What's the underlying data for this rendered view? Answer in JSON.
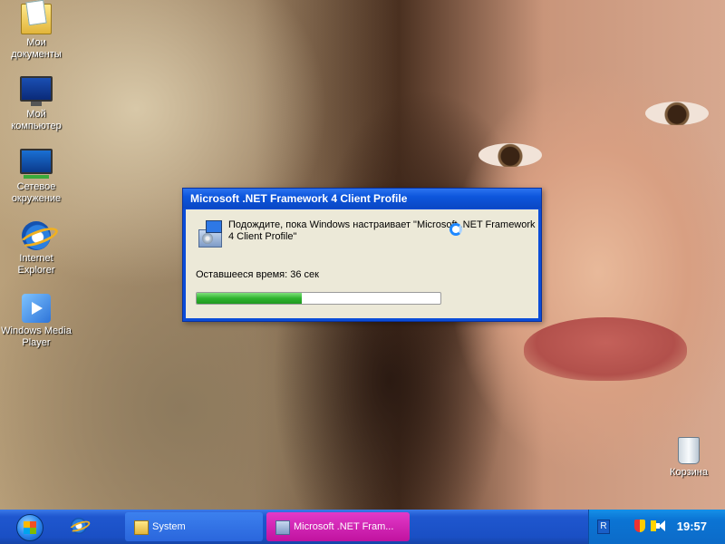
{
  "desktop": {
    "icons": [
      {
        "label": "Мои документы",
        "icon": "documents-folder-icon"
      },
      {
        "label": "Мой компьютер",
        "icon": "my-computer-icon"
      },
      {
        "label": "Сетевое окружение",
        "icon": "network-icon"
      },
      {
        "label": "Internet Explorer",
        "icon": "internet-explorer-icon"
      },
      {
        "label": "Windows Media Player",
        "icon": "media-player-icon"
      },
      {
        "label": "Корзина",
        "icon": "recycle-bin-icon"
      }
    ]
  },
  "dialog": {
    "title": "Microsoft .NET Framework 4 Client Profile",
    "message": "Подождите, пока Windows настраивает \"Microsoft .NET Framework 4 Client Profile\"",
    "remaining": "Оставшееся время: 36 сек",
    "progress_fraction": 0.43
  },
  "taskbar": {
    "start_icon": "windows-start-orb-icon",
    "quicklaunch_icon": "internet-explorer-icon",
    "items": [
      {
        "label": "System",
        "icon": "folder-icon"
      },
      {
        "label": "Microsoft .NET Fram...",
        "icon": "installer-icon"
      }
    ],
    "tray": {
      "lang": "R",
      "clock": "19:57"
    }
  },
  "colors": {
    "taskbar": "#1f57cf",
    "active_task": "#c0129f",
    "dialog_frame": "#0b4dd8",
    "progress": "#2fb32f"
  }
}
